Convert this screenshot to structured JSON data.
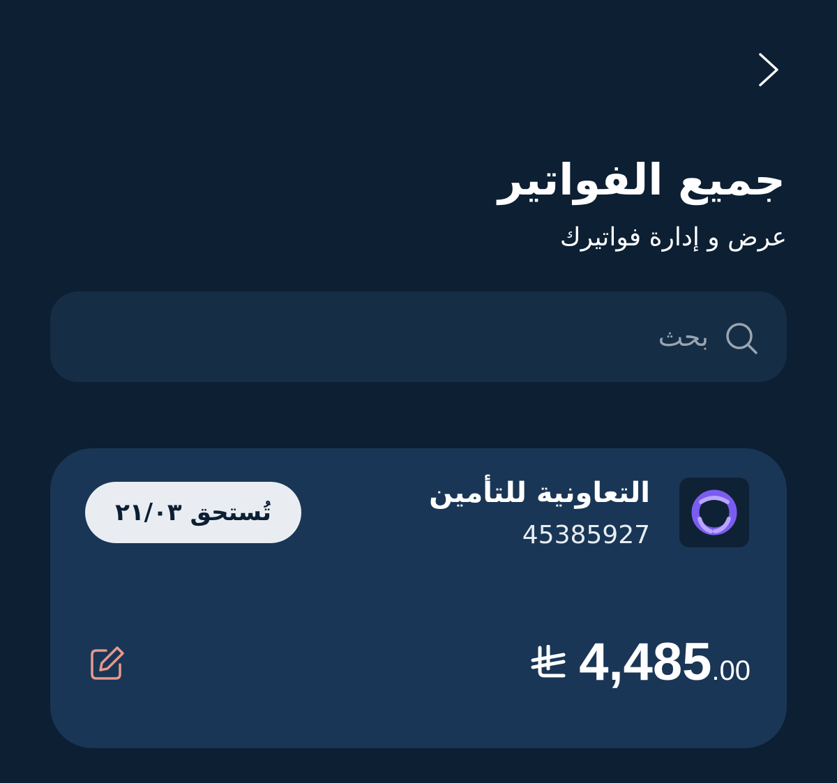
{
  "header": {
    "back_icon": "chevron-right-icon",
    "title": "جميع الفواتير",
    "subtitle": "عرض و إدارة فواتيرك"
  },
  "search": {
    "icon": "search-icon",
    "placeholder": "بحث",
    "value": ""
  },
  "invoices": [
    {
      "company_name": "التعاونية للتأمين",
      "account_number": "45385927",
      "due_label": "تُستحق ٢١/٠٣",
      "amount_main": "4,485",
      "amount_decimals": ".00",
      "currency_icon": "saudi-riyal-icon",
      "edit_icon": "edit-icon",
      "logo_icon": "tawuniya-logo"
    }
  ],
  "colors": {
    "background": "#0c1f33",
    "search_bg": "#152d45",
    "card_bg": "#1a3656",
    "badge_bg": "#e9edf2",
    "logo_accent": "#7b5cf0",
    "edit_icon": "#e8998c"
  }
}
